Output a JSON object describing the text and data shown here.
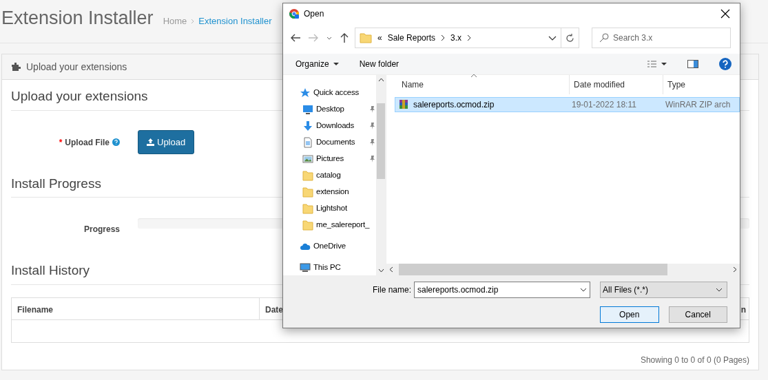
{
  "page": {
    "title": "Extension Installer",
    "breadcrumb": [
      {
        "label": "Home",
        "current": false
      },
      {
        "label": "Extension Installer",
        "current": true
      }
    ]
  },
  "panel": {
    "heading": "Upload your extensions",
    "upload": {
      "legend": "Upload your extensions",
      "required_mark": "*",
      "label": "Upload File",
      "button": "Upload"
    },
    "progress": {
      "legend": "Install Progress",
      "label": "Progress",
      "level": 0
    },
    "history": {
      "legend": "Install History",
      "columns": [
        "Filename",
        "Date",
        "n"
      ]
    },
    "pagination": "Showing 0 to 0 of 0 (0 Pages)"
  },
  "dialog": {
    "title": "Open",
    "address": {
      "overflow_mark": "«",
      "path": [
        "Sale Reports",
        "3.x"
      ]
    },
    "search": {
      "placeholder": "Search 3.x"
    },
    "toolbar": [
      "Organize",
      "New folder"
    ],
    "nav": [
      {
        "label": "Quick access",
        "kind": "star",
        "pinned": false
      },
      {
        "label": "Desktop",
        "kind": "desktop",
        "pinned": true
      },
      {
        "label": "Downloads",
        "kind": "download",
        "pinned": true
      },
      {
        "label": "Documents",
        "kind": "document",
        "pinned": true
      },
      {
        "label": "Pictures",
        "kind": "picture",
        "pinned": true
      },
      {
        "label": "catalog",
        "kind": "folder",
        "pinned": false
      },
      {
        "label": "extension",
        "kind": "folder",
        "pinned": false
      },
      {
        "label": "Lightshot",
        "kind": "folder",
        "pinned": false
      },
      {
        "label": "me_salereport_",
        "kind": "folder",
        "pinned": false
      },
      {
        "label": "OneDrive",
        "kind": "cloud",
        "pinned": false
      },
      {
        "label": "This PC",
        "kind": "pc",
        "pinned": false
      }
    ],
    "columns": [
      "Name",
      "Date modified",
      "Type"
    ],
    "files": [
      {
        "name": "salereports.ocmod.zip",
        "date": "19-01-2022 18:11",
        "type": "WinRAR ZIP arch",
        "selected": true
      }
    ],
    "file_name": {
      "label": "File name:",
      "value": "salereports.ocmod.zip"
    },
    "filter": "All Files (*.*)",
    "buttons": [
      {
        "label": "Open",
        "default": true
      },
      {
        "label": "Cancel",
        "default": false
      }
    ]
  }
}
